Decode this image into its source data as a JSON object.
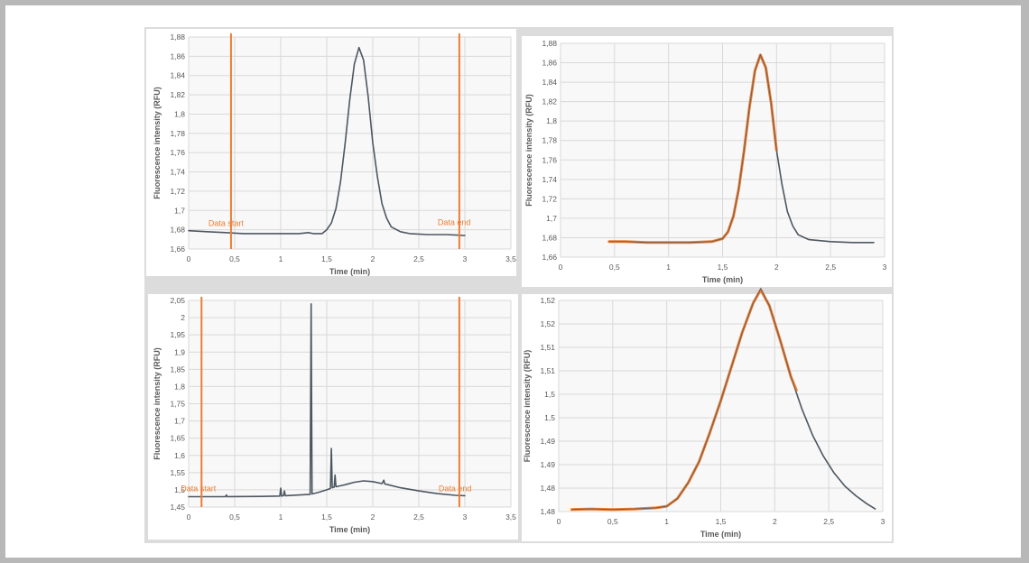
{
  "colors": {
    "data_line": "#4d5761",
    "fit_line": "#ed7d31",
    "marker_line": "#ed7d31",
    "grid": "#d9d9d9",
    "plot_bg": "#f8f8f8"
  },
  "chart_data": [
    {
      "type": "line",
      "xlabel": "Time (min)",
      "ylabel": "Fluorescence intensity (RFU)",
      "xlim": [
        0,
        3.5
      ],
      "ylim": [
        1.66,
        1.88
      ],
      "xticks": [
        "0",
        "0,5",
        "1",
        "1,5",
        "2",
        "2,5",
        "3",
        "3,5"
      ],
      "yticks": [
        "1,66",
        "1,68",
        "1,7",
        "1,72",
        "1,74",
        "1,76",
        "1,78",
        "1,8",
        "1,82",
        "1,84",
        "1,86",
        "1,88"
      ],
      "grid": true,
      "markers": [
        {
          "x": 0.46,
          "label": "Data start"
        },
        {
          "x": 2.94,
          "label": "Data end"
        }
      ],
      "series": [
        {
          "role": "data",
          "x": [
            0,
            0.2,
            0.4,
            0.6,
            0.8,
            1.0,
            1.2,
            1.3,
            1.35,
            1.45,
            1.5,
            1.55,
            1.6,
            1.65,
            1.7,
            1.75,
            1.8,
            1.85,
            1.9,
            1.95,
            2.0,
            2.05,
            2.1,
            2.15,
            2.2,
            2.3,
            2.4,
            2.6,
            2.8,
            3.0
          ],
          "y": [
            1.679,
            1.678,
            1.677,
            1.676,
            1.676,
            1.676,
            1.676,
            1.677,
            1.676,
            1.676,
            1.68,
            1.687,
            1.702,
            1.73,
            1.77,
            1.815,
            1.852,
            1.869,
            1.856,
            1.818,
            1.77,
            1.735,
            1.707,
            1.692,
            1.683,
            1.678,
            1.676,
            1.675,
            1.675,
            1.674
          ]
        }
      ]
    },
    {
      "type": "line",
      "xlabel": "Time (min)",
      "ylabel": "Fluorescence intensity (RFU)",
      "xlim": [
        0,
        3
      ],
      "ylim": [
        1.66,
        1.88
      ],
      "xticks": [
        "0",
        "0,5",
        "1",
        "1,5",
        "2",
        "2,5",
        "3"
      ],
      "yticks": [
        "1,66",
        "1,68",
        "1,7",
        "1,72",
        "1,74",
        "1,76",
        "1,78",
        "1,8",
        "1,82",
        "1,84",
        "1,86",
        "1,88"
      ],
      "grid": true,
      "markers": [],
      "series": [
        {
          "role": "data",
          "x": [
            0.45,
            0.6,
            0.8,
            1.0,
            1.2,
            1.4,
            1.5,
            1.55,
            1.6,
            1.65,
            1.7,
            1.75,
            1.8,
            1.85,
            1.9,
            1.95,
            2.0,
            2.05,
            2.1,
            2.15,
            2.2,
            2.3,
            2.5,
            2.7,
            2.9
          ],
          "y": [
            1.676,
            1.676,
            1.675,
            1.675,
            1.675,
            1.676,
            1.679,
            1.686,
            1.702,
            1.73,
            1.77,
            1.815,
            1.852,
            1.868,
            1.855,
            1.818,
            1.77,
            1.735,
            1.707,
            1.692,
            1.683,
            1.678,
            1.676,
            1.675,
            1.675
          ]
        },
        {
          "role": "fit",
          "x": [
            0.45,
            0.6,
            0.8,
            1.0,
            1.2,
            1.4,
            1.5,
            1.55,
            1.6,
            1.65,
            1.7,
            1.75,
            1.8,
            1.85,
            1.9,
            1.95,
            2.0
          ],
          "y": [
            1.676,
            1.676,
            1.675,
            1.675,
            1.675,
            1.676,
            1.679,
            1.686,
            1.702,
            1.73,
            1.77,
            1.815,
            1.852,
            1.868,
            1.855,
            1.818,
            1.77
          ]
        }
      ]
    },
    {
      "type": "line",
      "xlabel": "Time (min)",
      "ylabel": "Fluorescence intensity (RFU)",
      "xlim": [
        0,
        3.5
      ],
      "ylim": [
        1.45,
        2.05
      ],
      "xticks": [
        "0",
        "0,5",
        "1",
        "1,5",
        "2",
        "2,5",
        "3",
        "3,5"
      ],
      "yticks": [
        "1,45",
        "1,5",
        "1,55",
        "1,6",
        "1,65",
        "1,7",
        "1,75",
        "1,8",
        "1,85",
        "1,9",
        "1,95",
        "2",
        "2,05"
      ],
      "grid": true,
      "markers": [
        {
          "x": 0.14,
          "label": "Data start"
        },
        {
          "x": 2.94,
          "label": "Data end"
        }
      ],
      "series": [
        {
          "role": "data",
          "x": [
            0,
            0.4,
            0.41,
            0.42,
            0.8,
            0.99,
            1.0,
            1.01,
            1.03,
            1.04,
            1.05,
            1.25,
            1.32,
            1.33,
            1.34,
            1.4,
            1.5,
            1.54,
            1.55,
            1.56,
            1.58,
            1.59,
            1.6,
            1.7,
            1.8,
            1.9,
            2.0,
            2.1,
            2.12,
            2.13,
            2.15,
            2.3,
            2.5,
            2.7,
            2.9,
            3.0
          ],
          "y": [
            1.48,
            1.48,
            1.485,
            1.48,
            1.481,
            1.482,
            1.505,
            1.482,
            1.483,
            1.497,
            1.483,
            1.486,
            1.487,
            2.04,
            1.488,
            1.492,
            1.5,
            1.504,
            1.62,
            1.506,
            1.508,
            1.543,
            1.509,
            1.515,
            1.522,
            1.526,
            1.524,
            1.518,
            1.528,
            1.517,
            1.516,
            1.506,
            1.497,
            1.489,
            1.484,
            1.483
          ]
        }
      ]
    },
    {
      "type": "line",
      "xlabel": "Time (min)",
      "ylabel": "Fluorescence intensity (RFU)",
      "xlim": [
        0,
        3
      ],
      "ylim": [
        1.48,
        1.52
      ],
      "xticks": [
        "0",
        "0,5",
        "1",
        "1,5",
        "2",
        "2,5",
        "3"
      ],
      "yticks": [
        "1,48",
        "1,48",
        "1,49",
        "1,49",
        "1,5",
        "1,5",
        "1,51",
        "1,51",
        "1,52",
        "1,52"
      ],
      "grid": true,
      "markers": [],
      "series": [
        {
          "role": "data",
          "x": [
            0.12,
            0.3,
            0.5,
            0.7,
            0.9,
            1.0,
            1.1,
            1.2,
            1.3,
            1.4,
            1.5,
            1.6,
            1.7,
            1.8,
            1.87,
            1.95,
            2.05,
            2.15,
            2.25,
            2.35,
            2.45,
            2.55,
            2.65,
            2.75,
            2.85,
            2.93
          ],
          "y": [
            1.4804,
            1.4805,
            1.4804,
            1.4805,
            1.4807,
            1.481,
            1.4825,
            1.4855,
            1.4895,
            1.495,
            1.501,
            1.5075,
            1.514,
            1.5195,
            1.5222,
            1.519,
            1.5125,
            1.5055,
            1.4995,
            1.4945,
            1.4905,
            1.4873,
            1.4848,
            1.483,
            1.4815,
            1.4805
          ]
        },
        {
          "role": "fit",
          "x": [
            0.12,
            0.3,
            0.5,
            0.7,
            0.9,
            1.0,
            1.1,
            1.2,
            1.3,
            1.4,
            1.5,
            1.6,
            1.7,
            1.8,
            1.87,
            1.95,
            2.05,
            2.15,
            2.2
          ],
          "y": [
            1.4804,
            1.4805,
            1.4804,
            1.4805,
            1.4807,
            1.481,
            1.4825,
            1.4855,
            1.4895,
            1.495,
            1.501,
            1.5075,
            1.514,
            1.5195,
            1.522,
            1.519,
            1.5125,
            1.5055,
            1.503
          ]
        }
      ]
    }
  ]
}
